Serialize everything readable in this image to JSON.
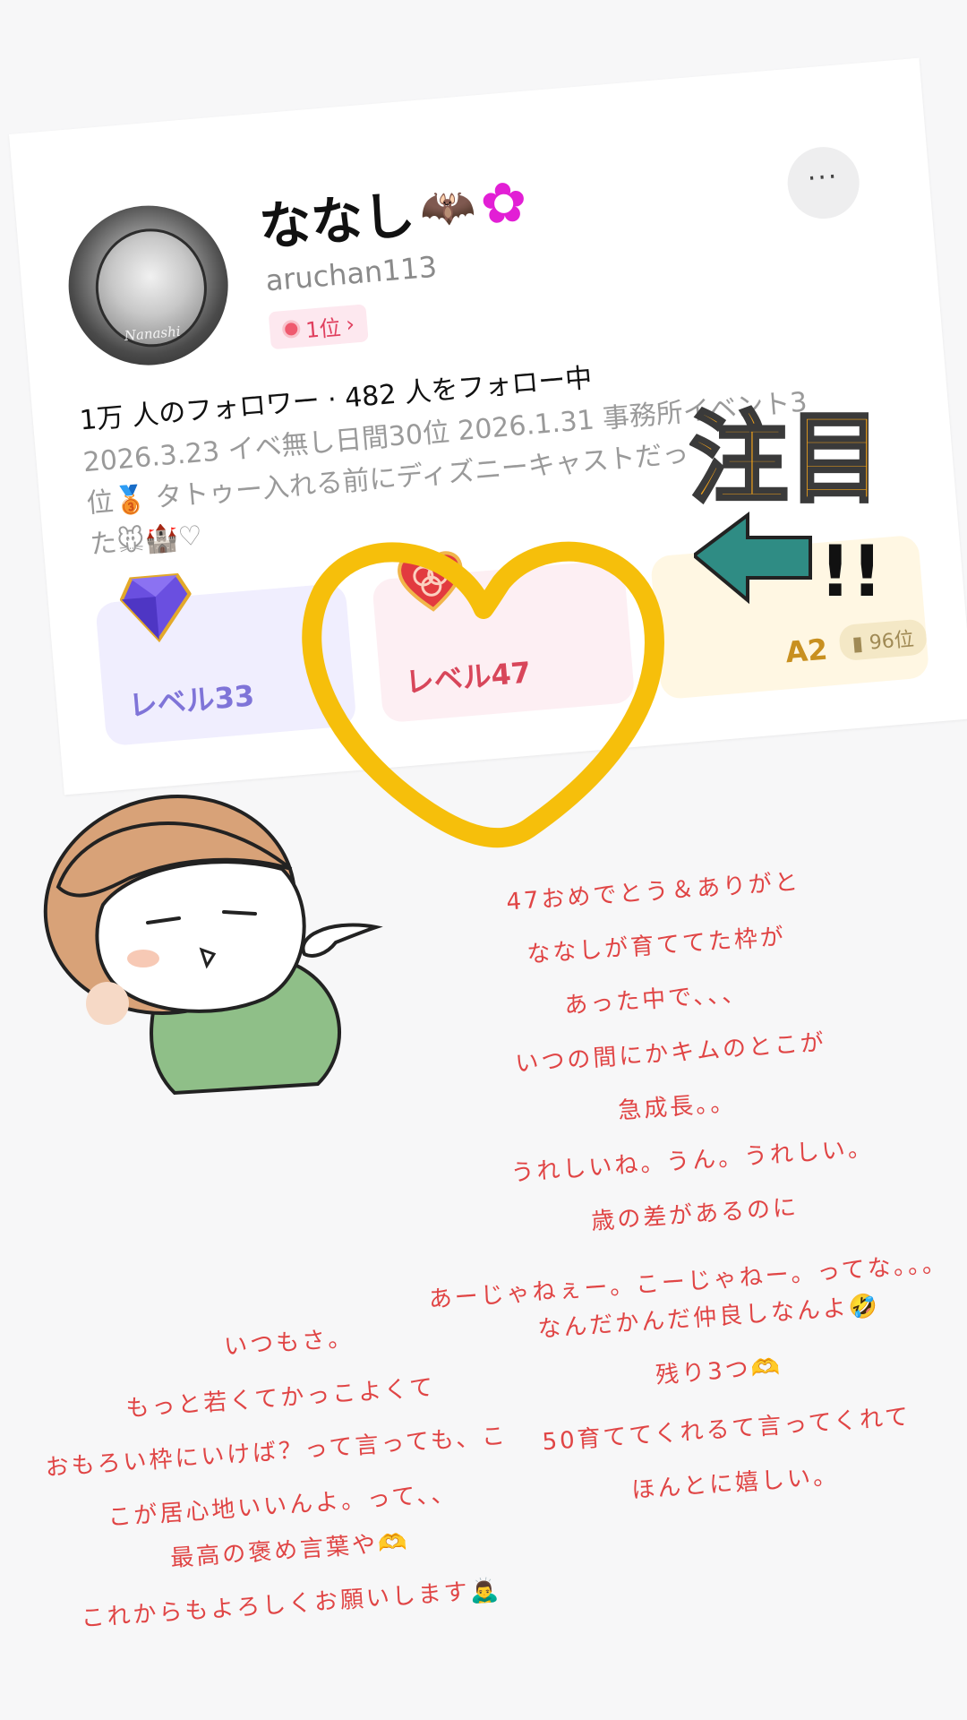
{
  "profile": {
    "name": "ななし",
    "name_emoji_bat": "🦇",
    "name_emoji_clover": "✿",
    "handle": "aruchan113",
    "rank_badge": "1位",
    "avatar_signature": "Nanashi",
    "follow_line": "1万 人のフォロワー · 482 人をフォロー中",
    "bio_lines": [
      "2026.3.23 イベ無し日間30位 2026.1.31 事務所イベント3",
      "位🥉 タトゥー入れる前にディズニーキャストだっ",
      "た🐭🏰♡"
    ],
    "more_button": "···"
  },
  "levels": [
    {
      "label": "レベル33",
      "icon": "diamond-icon"
    },
    {
      "label": "レベル47",
      "icon": "heart-gem-icon"
    },
    {
      "label": "A2",
      "rank": "96位",
      "icon": "a-badge-icon"
    }
  ],
  "stickers": {
    "chuumoku": "注目",
    "exclaim": "!!"
  },
  "right_notes": [
    "47おめでとう＆ありがと",
    "ななしが育ててた枠が",
    "あった中で、、、",
    "いつの間にかキムのとこが",
    "急成長。。",
    "うれしいね。うん。うれしい。",
    "歳の差があるのに",
    "あーじゃねぇー。こーじゃねー。ってな。。。",
    "なんだかんだ仲良しなんよ🤣",
    "残り3つ🫶",
    "50育ててくれるて言ってくれて",
    "ほんとに嬉しい。"
  ],
  "left_notes": [
    "いつもさ。",
    "もっと若くてかっこよくて",
    "おもろい枠にいけば？って言っても、こ",
    "こが居心地いいんよ。って、、",
    "最高の褒め言葉や🫶",
    "これからもよろしくお願いします🙇‍♂️"
  ],
  "colors": {
    "background": "#f7f7f8",
    "note_red": "#e04545",
    "highlight_ring": "#f6bf0b",
    "level_purple": "#7f74d8",
    "level_red": "#d8465a",
    "level_gold": "#c89020"
  }
}
